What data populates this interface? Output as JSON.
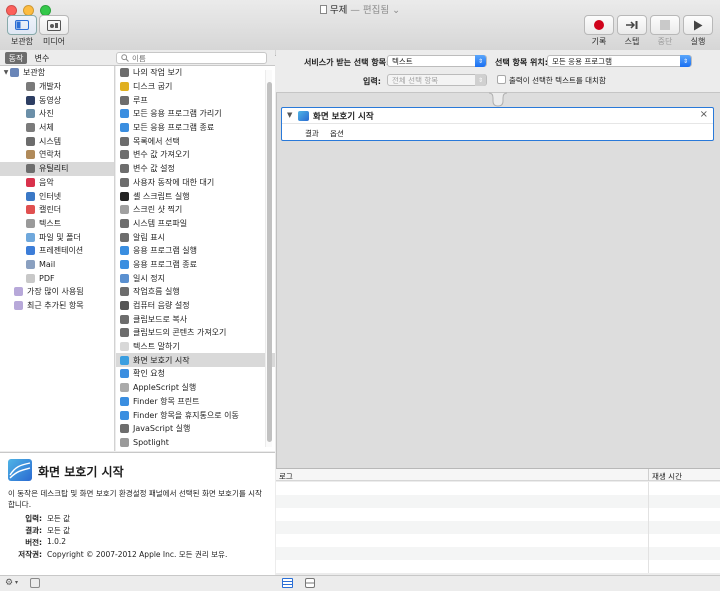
{
  "window": {
    "title": "무제",
    "edited": "— 편집됨",
    "title_chevron": "⌄"
  },
  "toolbar": {
    "library_label": "보관함",
    "media_label": "미디어",
    "record_label": "기록",
    "step_label": "스텝",
    "stop_label": "중단",
    "run_label": "실행"
  },
  "left_header": {
    "actions_tab": "동작",
    "variables_tab": "변수",
    "search_placeholder": "이름"
  },
  "library": {
    "root": "보관함",
    "items": [
      {
        "label": "개발자",
        "icon": "hammer-icon",
        "color": "#7a7a7a"
      },
      {
        "label": "동영상",
        "icon": "film-icon",
        "color": "#2d3e63"
      },
      {
        "label": "사진",
        "icon": "photo-icon",
        "color": "#6b8fa8"
      },
      {
        "label": "서체",
        "icon": "font-icon",
        "color": "#7b7b7b"
      },
      {
        "label": "시스템",
        "icon": "system-icon",
        "color": "#6c6c6c"
      },
      {
        "label": "연락처",
        "icon": "contacts-icon",
        "color": "#b08a5a"
      },
      {
        "label": "유틸리티",
        "icon": "utility-icon",
        "color": "#6d6d6d"
      },
      {
        "label": "음악",
        "icon": "music-icon",
        "color": "#d9314c"
      },
      {
        "label": "인터넷",
        "icon": "globe-icon",
        "color": "#3a78c6"
      },
      {
        "label": "캘린더",
        "icon": "calendar-icon",
        "color": "#e05050"
      },
      {
        "label": "텍스트",
        "icon": "text-icon",
        "color": "#9a9a9a"
      },
      {
        "label": "파일 및 폴더",
        "icon": "folder-icon",
        "color": "#6fa8dc"
      },
      {
        "label": "프레젠테이션",
        "icon": "presentation-icon",
        "color": "#3c7dd8"
      },
      {
        "label": "Mail",
        "icon": "mail-icon",
        "color": "#8aa0c0"
      },
      {
        "label": "PDF",
        "icon": "pdf-icon",
        "color": "#c8c8c8"
      }
    ],
    "extra": [
      {
        "label": "가장 많이 사용됨",
        "icon": "smart-folder-icon"
      },
      {
        "label": "최근 추가된 항목",
        "icon": "smart-folder-icon"
      }
    ],
    "selected_index": 6
  },
  "actions": {
    "items": [
      {
        "label": "나의 작업 보기",
        "icon": "utility-icon",
        "color": "#6d6d6d"
      },
      {
        "label": "디스크 굽기",
        "icon": "burn-icon",
        "color": "#e0b020"
      },
      {
        "label": "루프",
        "icon": "loop-icon",
        "color": "#6d6d6d"
      },
      {
        "label": "모든 응용 프로그램 가리기",
        "icon": "app-icon",
        "color": "#3a8ee0"
      },
      {
        "label": "모든 응용 프로그램 종료",
        "icon": "app-icon",
        "color": "#3a8ee0"
      },
      {
        "label": "목록에서 선택",
        "icon": "utility-icon",
        "color": "#6d6d6d"
      },
      {
        "label": "변수 값 가져오기",
        "icon": "utility-icon",
        "color": "#6d6d6d"
      },
      {
        "label": "변수 값 설정",
        "icon": "utility-icon",
        "color": "#6d6d6d"
      },
      {
        "label": "사용자 동작에 대한 대기",
        "icon": "utility-icon",
        "color": "#6d6d6d"
      },
      {
        "label": "셸 스크립트 실행",
        "icon": "terminal-icon",
        "color": "#222222"
      },
      {
        "label": "스크린 샷 찍기",
        "icon": "camera-icon",
        "color": "#a0a0a0"
      },
      {
        "label": "시스템 프로파일",
        "icon": "utility-icon",
        "color": "#6d6d6d"
      },
      {
        "label": "알림 표시",
        "icon": "utility-icon",
        "color": "#6d6d6d"
      },
      {
        "label": "응용 프로그램 실행",
        "icon": "app-icon",
        "color": "#3a8ee0"
      },
      {
        "label": "응용 프로그램 종료",
        "icon": "app-icon",
        "color": "#3a8ee0"
      },
      {
        "label": "일시 정지",
        "icon": "pause-icon",
        "color": "#5a90d0"
      },
      {
        "label": "작업흐름 실행",
        "icon": "utility-icon",
        "color": "#6d6d6d"
      },
      {
        "label": "컴퓨터 음량 설정",
        "icon": "volume-icon",
        "color": "#555555"
      },
      {
        "label": "클립보드로 복사",
        "icon": "utility-icon",
        "color": "#6d6d6d"
      },
      {
        "label": "클립보드의 콘텐츠 가져오기",
        "icon": "utility-icon",
        "color": "#6d6d6d"
      },
      {
        "label": "텍스트 말하기",
        "icon": "document-icon",
        "color": "#d8d8d8"
      },
      {
        "label": "화면 보호기 시작",
        "icon": "screensaver-icon",
        "color": "#3a9ee0"
      },
      {
        "label": "확인 요청",
        "icon": "finder-icon",
        "color": "#3a8ee0"
      },
      {
        "label": "AppleScript 실행",
        "icon": "applescript-icon",
        "color": "#aaaaaa"
      },
      {
        "label": "Finder 항목 프린트",
        "icon": "finder-icon",
        "color": "#3a8ee0"
      },
      {
        "label": "Finder 항목을 휴지통으로 이동",
        "icon": "finder-icon",
        "color": "#3a8ee0"
      },
      {
        "label": "JavaScript 실행",
        "icon": "utility-icon",
        "color": "#6d6d6d"
      },
      {
        "label": "Spotlight",
        "icon": "spotlight-icon",
        "color": "#9a9a9a"
      }
    ],
    "selected_index": 21
  },
  "info": {
    "title": "화면 보호기 시작",
    "description": "이 동작은 데스크탑 및 화면 보호기 환경설정 패널에서 선택된 화면 보호기를 시작합니다.",
    "input_key": "입력:",
    "input_value": "모든 값",
    "result_key": "결과:",
    "result_value": "모든 값",
    "version_key": "버전:",
    "version_value": "1.0.2",
    "copyright_key": "저작권:",
    "copyright_value": "Copyright © 2007-2012 Apple Inc.  모든 권리 보유."
  },
  "workflow": {
    "service_label": "서비스가 받는 선택 항목:",
    "service_value": "텍스트",
    "location_label": "선택 항목 위치:",
    "location_value": "모든 응용 프로그램",
    "input_label": "입력:",
    "input_value": "전체 선택 항목",
    "replace_label": "출력이 선택한 텍스트를 대치함"
  },
  "action_card": {
    "title": "화면 보호기 시작",
    "close": "×",
    "tab_results": "결과",
    "tab_options": "옵션"
  },
  "log": {
    "col_log": "로그",
    "col_duration": "재생 시간"
  }
}
